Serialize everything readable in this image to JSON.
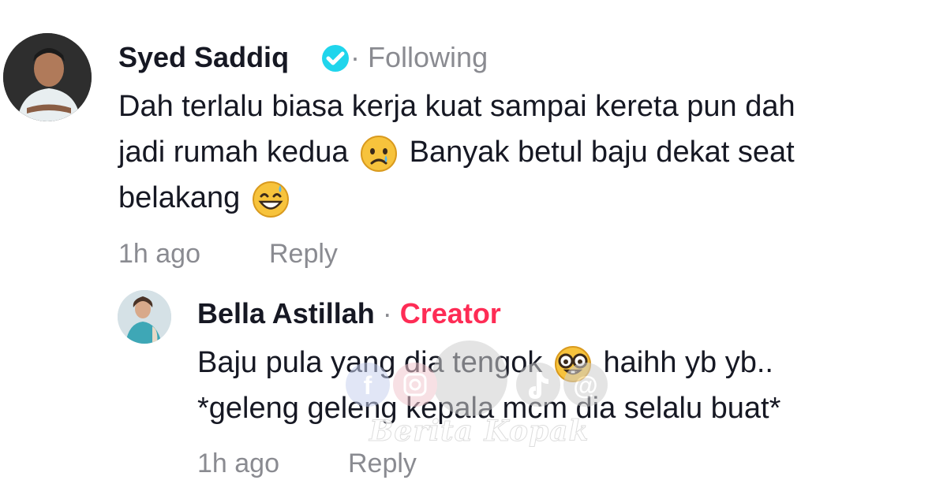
{
  "comment": {
    "author": "Syed Saddiq",
    "dot": "·",
    "follow_status": "Following",
    "lines": [
      "Dah terlalu biasa kerja kuat sampai kereta pun dah",
      "jadi rumah kedua",
      "Banyak betul baju dekat seat",
      "belakang"
    ],
    "time": "1h ago",
    "reply_label": "Reply",
    "emojis": [
      "crying-face",
      "grinning-sweat-face"
    ]
  },
  "reply": {
    "author": "Bella Astillah",
    "dot": "·",
    "badge": "Creator",
    "line1_start": "Baju pula yang dia tengok",
    "line1_end": "haihh yb yb..",
    "line2": "*geleng geleng kepala mcm dia selalu buat*",
    "time": "1h ago",
    "reply_label": "Reply",
    "emojis": [
      "nerd-face"
    ]
  },
  "watermark": {
    "text": "Berita Kopak",
    "icons": [
      "facebook-icon",
      "instagram-icon",
      "tiktok-icon",
      "threads-icon"
    ]
  },
  "colors": {
    "text": "#161823",
    "muted": "#8a8b91",
    "creator": "#fe2c55",
    "verified": "#20d5ec"
  }
}
